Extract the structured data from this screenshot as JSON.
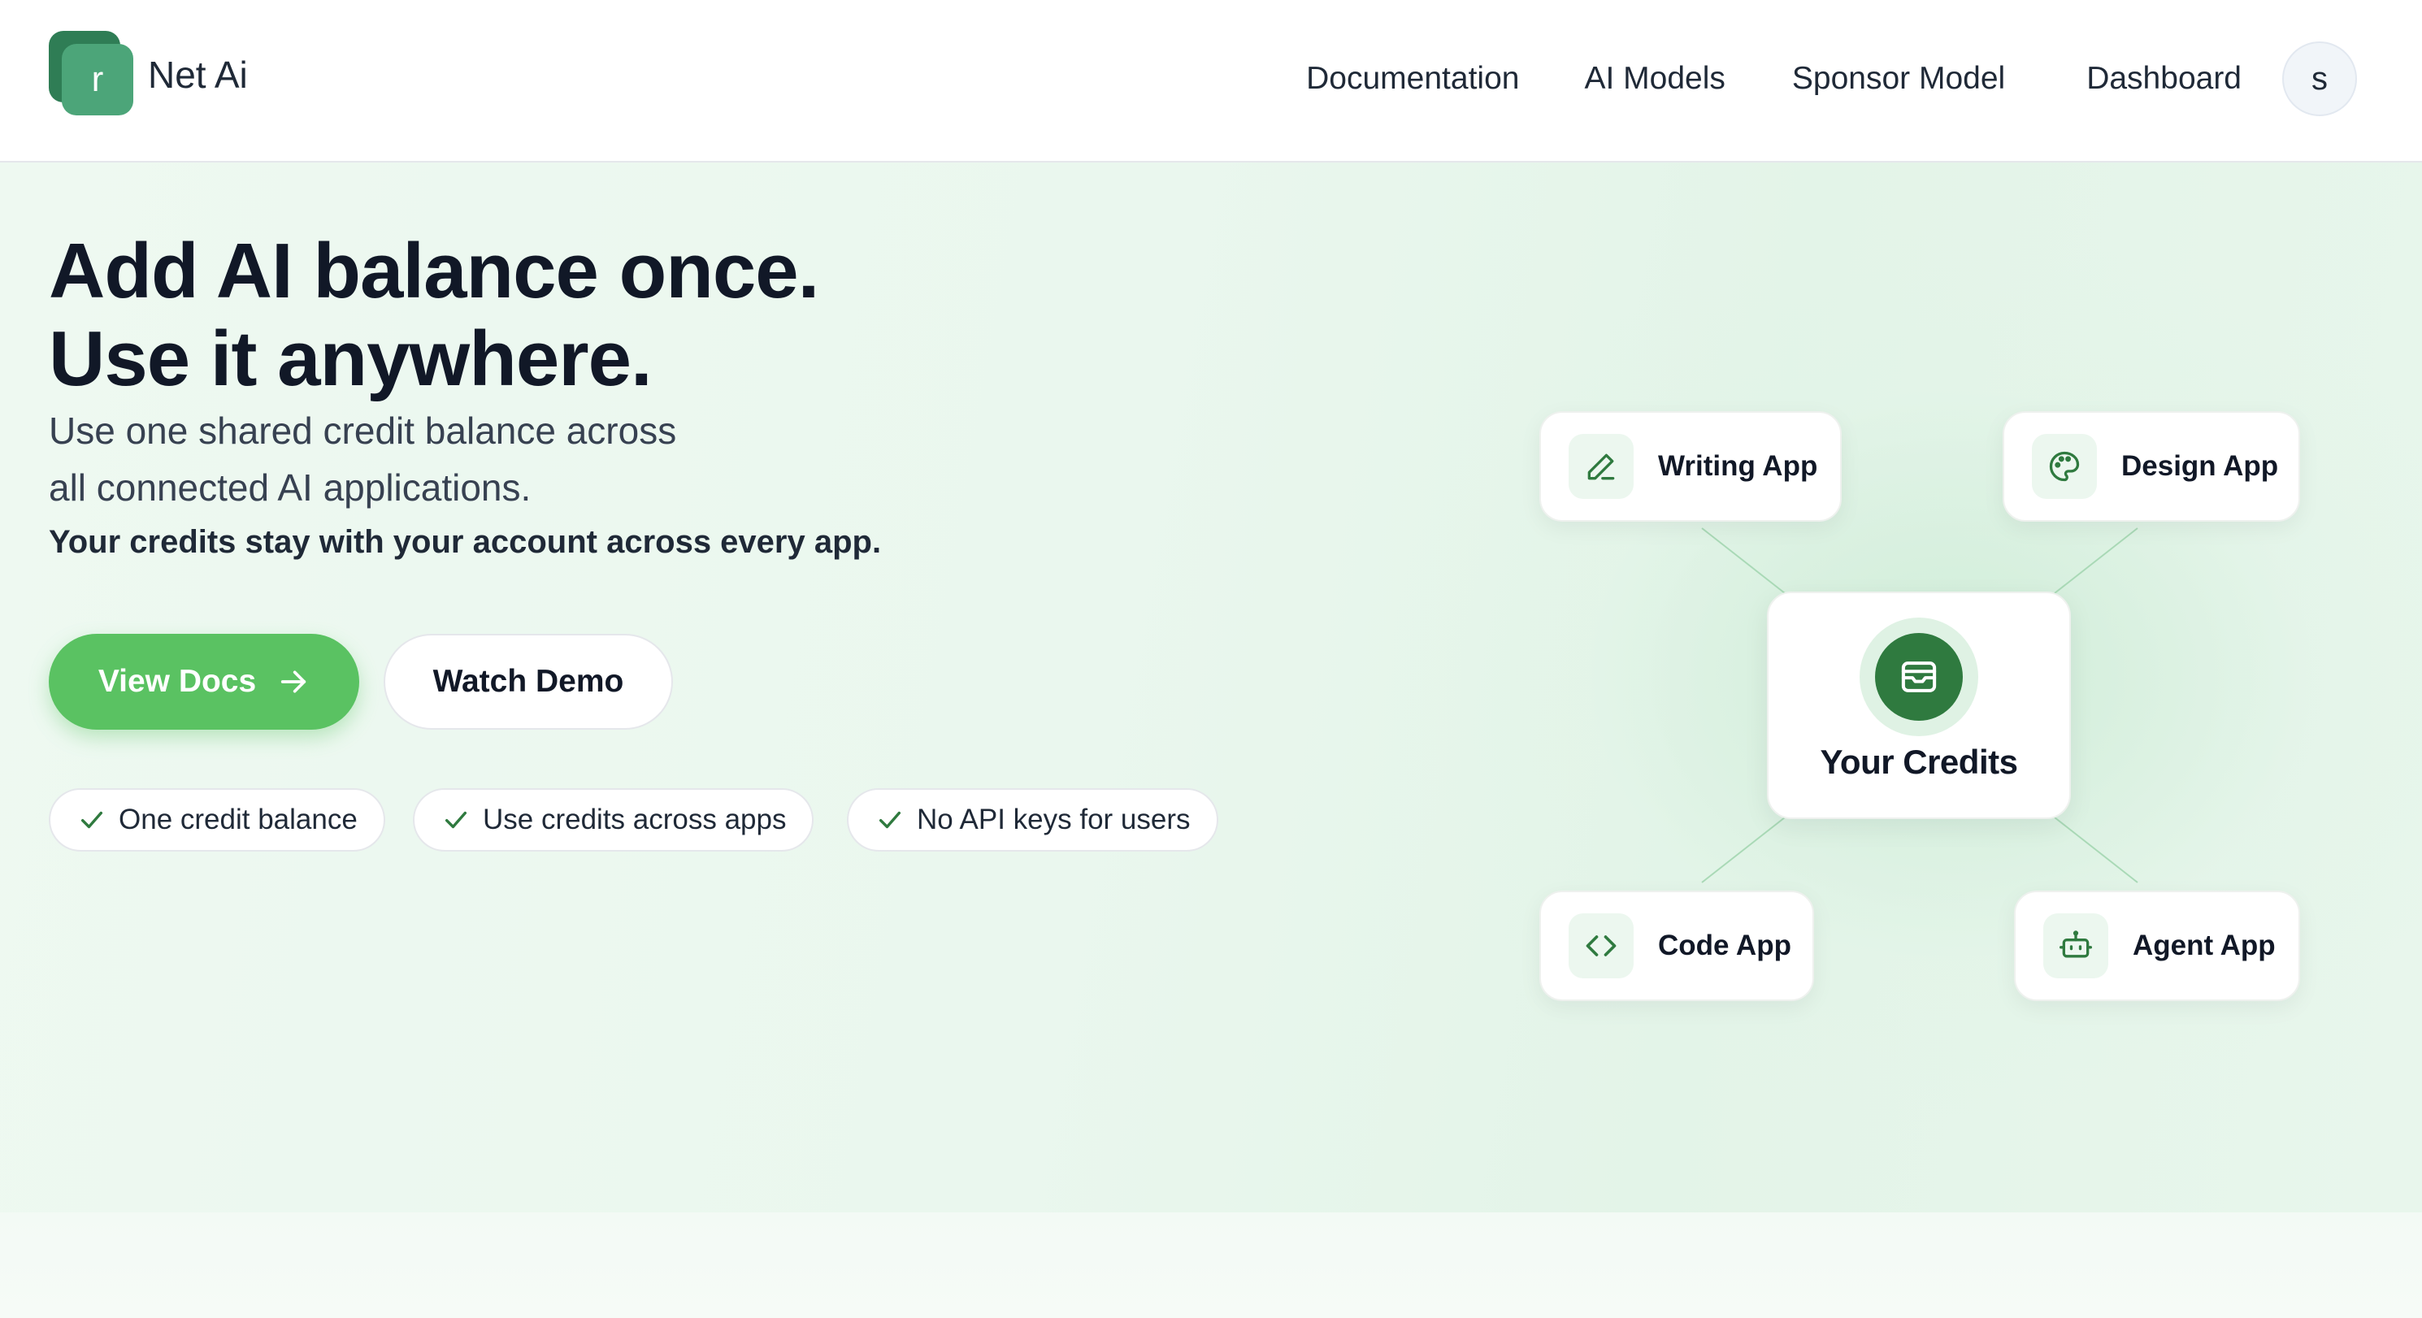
{
  "nav": {
    "logo_letter": "r",
    "brand_name": "Net Ai",
    "links": [
      "Documentation",
      "AI Models",
      "Sponsor Model",
      "Dashboard"
    ],
    "avatar_initial": "s"
  },
  "hero": {
    "headline": [
      "Add AI balance once.",
      "Use it anywhere."
    ],
    "subtext": [
      "Use one shared credit balance across",
      "all connected AI applications."
    ],
    "subtext_bold": "Your credits stay with your account across every app.",
    "primary_button": "View Docs",
    "secondary_button": "Watch Demo",
    "features": [
      "One credit balance",
      "Use credits across apps",
      "No API keys for users"
    ]
  },
  "diagram": {
    "center_label": "Your Credits",
    "center_icon": "wallet-icon",
    "apps": [
      {
        "label": "Writing App",
        "icon": "pencil-icon"
      },
      {
        "label": "Design App",
        "icon": "palette-icon"
      },
      {
        "label": "Code App",
        "icon": "code-icon"
      },
      {
        "label": "Agent App",
        "icon": "bot-icon"
      }
    ]
  },
  "colors": {
    "accent": "#5ac262",
    "brand_dark": "#2f7a3f",
    "logo": "#4ca579",
    "hero_bg": "#eaf7ee",
    "text": "#111827"
  }
}
